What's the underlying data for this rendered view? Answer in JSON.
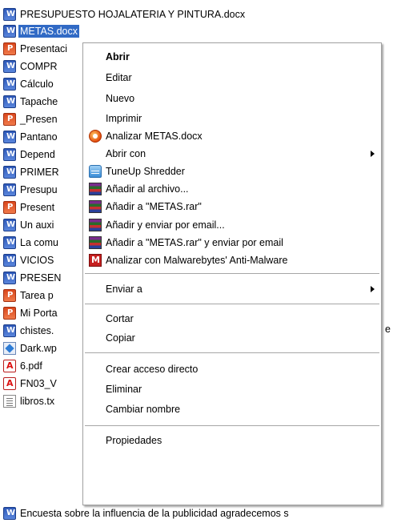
{
  "file_list": [
    {
      "label": "PRESUPUESTO HOJALATERIA Y PINTURA.docx",
      "icon": "word-doc-icon",
      "selected": false
    },
    {
      "label": "METAS.docx",
      "icon": "word-doc-icon",
      "selected": true
    },
    {
      "label": "Presentaci",
      "icon": "powerpoint-icon",
      "selected": false
    },
    {
      "label": "COMPR",
      "icon": "word-doc-icon",
      "selected": false
    },
    {
      "label": "Cálculo",
      "icon": "word-doc-icon",
      "selected": false
    },
    {
      "label": "Tapache",
      "icon": "word-doc-icon",
      "selected": false
    },
    {
      "label": "_Presen",
      "icon": "powerpoint-icon",
      "selected": false
    },
    {
      "label": "Pantano",
      "icon": "word-doc-icon",
      "selected": false
    },
    {
      "label": "Depend",
      "icon": "word-doc-icon",
      "selected": false
    },
    {
      "label": "PRIMER",
      "icon": "word-doc-icon",
      "selected": false
    },
    {
      "label": "Presupu",
      "icon": "word-doc-icon",
      "selected": false
    },
    {
      "label": "Present",
      "icon": "powerpoint-icon",
      "selected": false
    },
    {
      "label": "Un auxi",
      "icon": "word-doc-icon",
      "selected": false
    },
    {
      "label": "La comu",
      "icon": "word-doc-icon",
      "selected": false
    },
    {
      "label": "VICIOS",
      "icon": "word-doc-icon",
      "selected": false
    },
    {
      "label": "PRESEN",
      "icon": "word-doc-icon",
      "selected": false
    },
    {
      "label": "Tarea p",
      "icon": "powerpoint-icon",
      "selected": false
    },
    {
      "label": "Mi Porta",
      "icon": "powerpoint-icon",
      "selected": false
    },
    {
      "label": "chistes.",
      "icon": "word-doc-icon",
      "selected": false
    },
    {
      "label": "Dark.wp",
      "icon": "wordpad-icon",
      "selected": false
    },
    {
      "label": "6.pdf",
      "icon": "pdf-icon",
      "selected": false
    },
    {
      "label": "FN03_V",
      "icon": "pdf-icon",
      "selected": false
    },
    {
      "label": "libros.tx",
      "icon": "text-file-icon",
      "selected": false
    },
    {
      "label": "Encuesta sobre la influencia de la publicidad agradecemos s",
      "icon": "word-doc-icon",
      "selected": false
    }
  ],
  "file_list_overflow_char": "e",
  "context_menu": {
    "items": [
      {
        "id": "abrir",
        "label": "Abrir",
        "bold": true
      },
      {
        "id": "editar",
        "label": "Editar"
      },
      {
        "id": "nuevo",
        "label": "Nuevo"
      },
      {
        "id": "imprimir",
        "label": "Imprimir"
      },
      {
        "id": "analizar",
        "label": "Analizar METAS.docx",
        "icon": "antivirus-scan-icon"
      },
      {
        "id": "abrir-con",
        "label": "Abrir con",
        "submenu": true
      },
      {
        "id": "tuneup",
        "label": "TuneUp Shredder",
        "icon": "shredder-icon"
      },
      {
        "id": "anadir-archivo",
        "label": "Añadir al archivo...",
        "icon": "winrar-icon"
      },
      {
        "id": "anadir-rar",
        "label": "Añadir a \"METAS.rar\"",
        "icon": "winrar-icon"
      },
      {
        "id": "anadir-email",
        "label": "Añadir y enviar por email...",
        "icon": "winrar-icon"
      },
      {
        "id": "anadir-rar-email",
        "label": "Añadir a \"METAS.rar\" y enviar por email",
        "icon": "winrar-icon"
      },
      {
        "id": "malwarebytes",
        "label": "Analizar con Malwarebytes' Anti-Malware",
        "icon": "malwarebytes-icon"
      },
      {
        "id": "enviar-a",
        "label": "Enviar a",
        "submenu": true
      },
      {
        "id": "cortar",
        "label": "Cortar"
      },
      {
        "id": "copiar",
        "label": "Copiar"
      },
      {
        "id": "crear-acceso",
        "label": "Crear acceso directo"
      },
      {
        "id": "eliminar",
        "label": "Eliminar"
      },
      {
        "id": "cambiar-nombre",
        "label": "Cambiar nombre"
      },
      {
        "id": "propiedades",
        "label": "Propiedades"
      }
    ]
  },
  "colors": {
    "selection": "#316ac5",
    "menu_border": "#a0a0a0",
    "separator": "#a6a6a6"
  }
}
